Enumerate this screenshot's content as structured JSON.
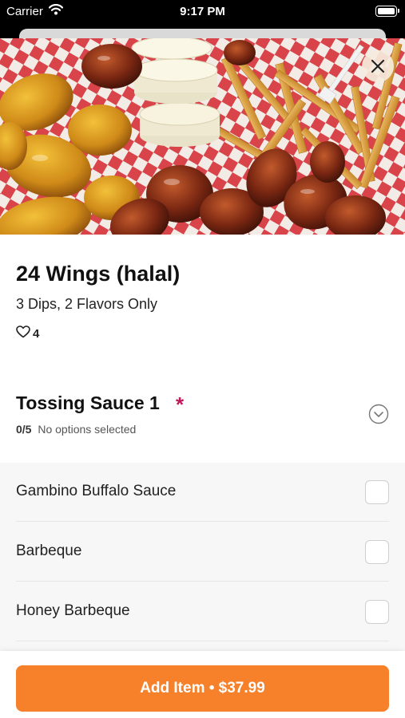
{
  "status_bar": {
    "carrier": "Carrier",
    "time": "9:17 PM"
  },
  "item": {
    "title": "24 Wings (halal)",
    "subtitle": "3 Dips, 2 Flavors Only",
    "likes": "4",
    "image_alt": "wings-and-fries-photo"
  },
  "section": {
    "title": "Tossing Sauce 1",
    "required_marker": "*",
    "count": "0/5",
    "status": "No options selected"
  },
  "options": [
    {
      "label": "Gambino Buffalo Sauce",
      "checked": false
    },
    {
      "label": "Barbeque",
      "checked": false
    },
    {
      "label": "Honey Barbeque",
      "checked": false
    }
  ],
  "footer": {
    "add_label": "Add Item • $37.99"
  },
  "colors": {
    "accent": "#f7812a",
    "required": "#c2185b"
  },
  "icons": {
    "close": "close-icon",
    "heart": "heart-icon",
    "chevron": "chevron-down-icon",
    "wifi": "wifi-icon",
    "battery": "battery-icon"
  }
}
